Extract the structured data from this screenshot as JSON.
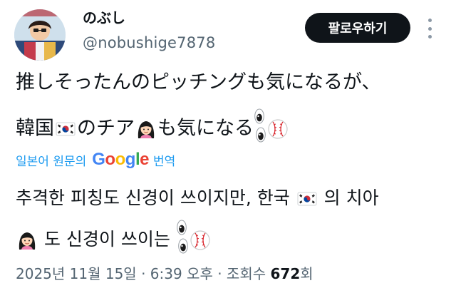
{
  "profile": {
    "display_name": "のぶし",
    "handle": "@nobushige7878",
    "follow_label": "팔로우하기"
  },
  "tweet": {
    "line1": "推しそったんのピッチングも気になるが、",
    "line2_a": "韓国",
    "line2_b": "のチア",
    "line2_c": "も気になる"
  },
  "translation": {
    "source_label": "일본어 원문의",
    "provider": "Google",
    "action": "번역",
    "line1_a": "추격한 피칭도 신경이 쓰이지만, 한국",
    "line1_b": "의 치아",
    "line2": "도 신경이 쓰이는"
  },
  "meta": {
    "datetime": "2025년 11월 15일 · 6:39 오후 · 조회수",
    "views": "672",
    "views_unit": "회"
  },
  "icons": [
    "avatar",
    "more-icon",
    "korea-flag-emoji",
    "girl-emoji",
    "eyes-emoji",
    "baseball-emoji"
  ],
  "colors": {
    "follow_bg": "#0f1419",
    "link": "#1d9bf0",
    "muted": "#536471"
  }
}
